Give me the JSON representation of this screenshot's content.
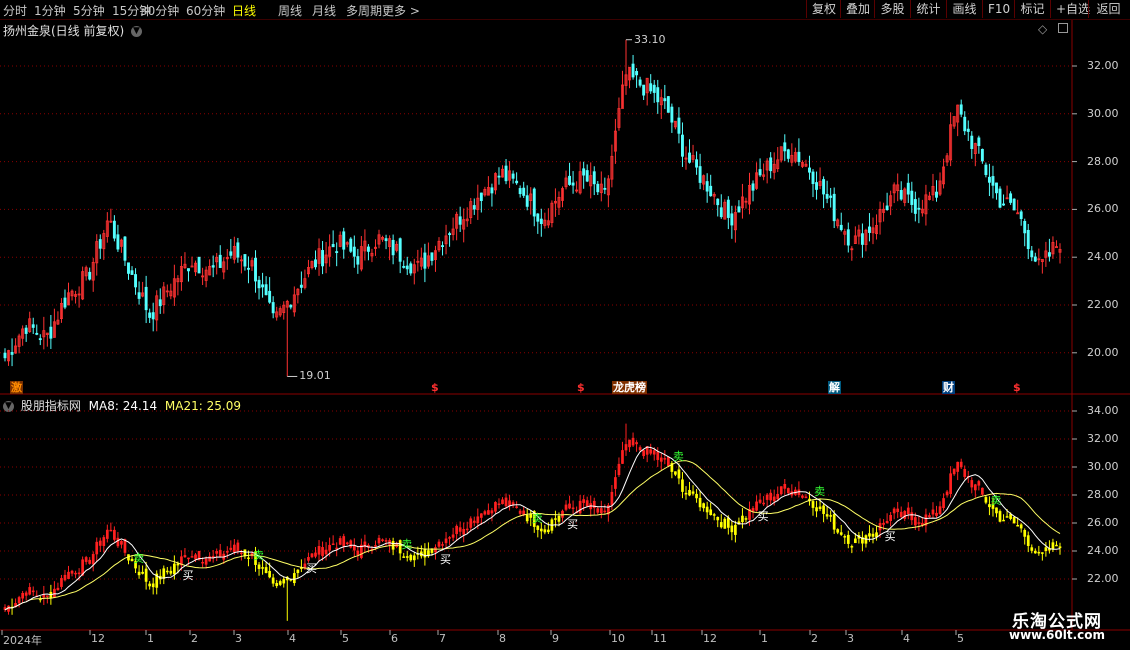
{
  "toolbar": {
    "periods": [
      "分时",
      "1分钟",
      "5分钟",
      "15分钟",
      "30分钟",
      "60分钟",
      "日线",
      "周线",
      "月线",
      "多周期",
      "更多 >"
    ],
    "active_period": "日线",
    "right_buttons": [
      "复权",
      "叠加",
      "多股",
      "统计",
      "画线",
      "F10",
      "标记",
      "+自选",
      "返回"
    ]
  },
  "main_chart": {
    "title": "扬州金泉(日线 前复权)",
    "high_label": "33.10",
    "low_label": "19.01",
    "y_ticks": [
      "32.00",
      "30.00",
      "28.00",
      "26.00",
      "24.00",
      "22.00",
      "20.00"
    ],
    "events": [
      {
        "text": "激",
        "color": "#ff8c00",
        "bg": "#7a3000"
      },
      {
        "text": "$",
        "color": "#ff3030",
        "bg": ""
      },
      {
        "text": "$",
        "color": "#ff3030",
        "bg": ""
      },
      {
        "text": "龙虎榜",
        "color": "#ffffff",
        "bg": "#803000"
      },
      {
        "text": "解",
        "color": "#ffffff",
        "bg": "#005a80"
      },
      {
        "text": "财",
        "color": "#ffffff",
        "bg": "#004080"
      },
      {
        "text": "$",
        "color": "#ff3030",
        "bg": ""
      }
    ]
  },
  "indicator": {
    "name": "股朋指标网",
    "ma8_label": "MA8: 24.14",
    "ma21_label": "MA21: 25.09",
    "y_ticks": [
      "34.00",
      "32.00",
      "30.00",
      "28.00",
      "26.00",
      "24.00",
      "22.00"
    ],
    "buy_label": "买",
    "sell_label": "卖"
  },
  "x_axis": [
    "2024年",
    "12",
    "1",
    "2",
    "3",
    "4",
    "5",
    "6",
    "7",
    "8",
    "9",
    "10",
    "11",
    "12",
    "1",
    "2",
    "3",
    "4",
    "5"
  ],
  "watermark": {
    "name": "乐淘公式网",
    "url": "www.60lt.com"
  },
  "colors": {
    "up": "#ff3232",
    "down": "#54ffff",
    "ma8": "#ffffff",
    "ma21": "#ffff66",
    "bull": "#ff2020",
    "bear": "#ffff00",
    "grid": "#8a0000"
  },
  "chart_data": {
    "type": "candlestick",
    "title": "扬州金泉(日线 前复权)",
    "ylim": [
      18.5,
      33.6
    ],
    "key_points": [
      {
        "label": "low",
        "value": 19.01
      },
      {
        "label": "high",
        "value": 33.1
      }
    ],
    "anchors": [
      19.8,
      21.2,
      20.6,
      22.4,
      23.2,
      25.6,
      23.5,
      21.6,
      22.8,
      23.9,
      23.4,
      24.2,
      23.6,
      21.2,
      22.6,
      23.8,
      24.6,
      24.0,
      24.8,
      24.2,
      23.5,
      24.7,
      25.7,
      26.7,
      27.5,
      26.8,
      25.6,
      26.9,
      27.3,
      26.5,
      31.6,
      31.1,
      30.2,
      28.1,
      27.0,
      25.6,
      26.8,
      27.9,
      28.6,
      27.6,
      26.0,
      24.6,
      25.4,
      26.7,
      26.2,
      26.6,
      30.2,
      28.4,
      26.5,
      25.8,
      23.5,
      24.7
    ],
    "ma8_end": 24.14,
    "ma21_end": 25.09
  }
}
